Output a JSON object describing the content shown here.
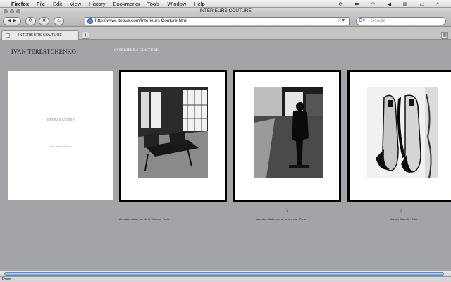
{
  "menubar": {
    "items": [
      "Firefox",
      "File",
      "Edit",
      "View",
      "History",
      "Bookmarks",
      "Tools",
      "Window",
      "Help"
    ]
  },
  "window": {
    "title": "INTERIEURS COUTURE"
  },
  "toolbar": {
    "url": "http://www.itopus.com/interieurs Couture.html",
    "search_placeholder": "Google"
  },
  "tabs": [
    {
      "label": "INTERIEURS COUTURE"
    }
  ],
  "page": {
    "author": "IVAN TERESTCHENKO",
    "site_title": "INTERIEURS COUTURE",
    "cover": {
      "title": "Interieurs Couture",
      "subtitle": "Ivan Terestchenko"
    },
    "photos": [
      {
        "number": "",
        "caption": "Azzedine Alaïa, rue de la Verrerie, Paris"
      },
      {
        "number": "1",
        "caption": "Azzedine Alaïa, rue de la Verrerie, Paris"
      },
      {
        "number": "2",
        "caption": "Manolo Blahnik - Bath"
      }
    ]
  },
  "status": {
    "text": "Done"
  }
}
